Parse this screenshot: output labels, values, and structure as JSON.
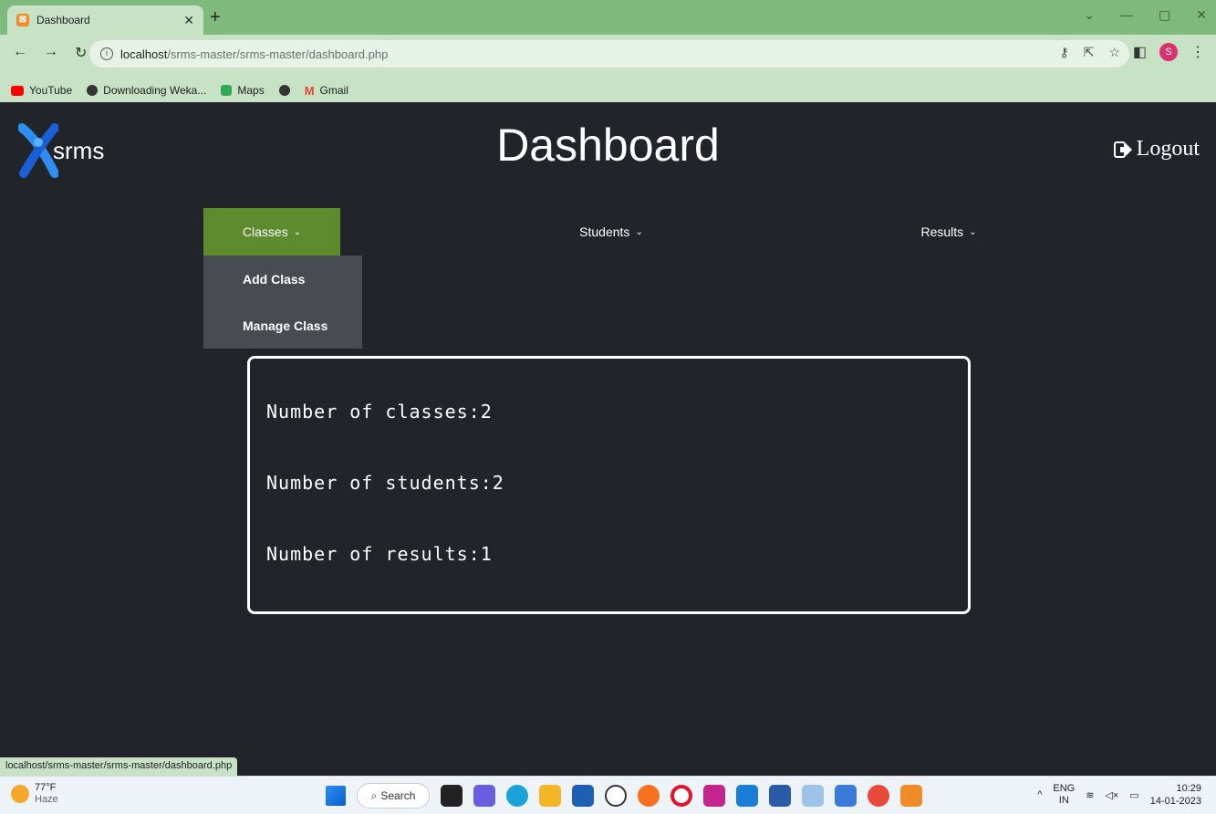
{
  "browser": {
    "tab_title": "Dashboard",
    "url_host": "localhost",
    "url_path": "/srms-master/srms-master/dashboard.php",
    "bookmarks": [
      "YouTube",
      "Downloading Weka...",
      "Maps",
      "Gmail"
    ],
    "avatar_letter": "S",
    "status_url": "localhost/srms-master/srms-master/dashboard.php"
  },
  "header": {
    "logo_text": "srms",
    "title": "Dashboard",
    "logout_label": "Logout"
  },
  "nav": {
    "classes": "Classes",
    "students": "Students",
    "results": "Results"
  },
  "dropdown": {
    "items": [
      "Add Class",
      "Manage Class"
    ]
  },
  "stats": {
    "classes": "Number of classes:2",
    "students": "Number of students:2",
    "results": "Number of results:1"
  },
  "taskbar": {
    "temp": "77°F",
    "weather": "Haze",
    "search_label": "Search",
    "lang": "ENG",
    "region": "IN",
    "time": "10:29",
    "date": "14-01-2023"
  },
  "colors": {
    "page_bg": "#212529",
    "nav_active": "#5e8b2e",
    "dropdown_bg": "#484b50",
    "chrome_green": "#7dba7c"
  }
}
